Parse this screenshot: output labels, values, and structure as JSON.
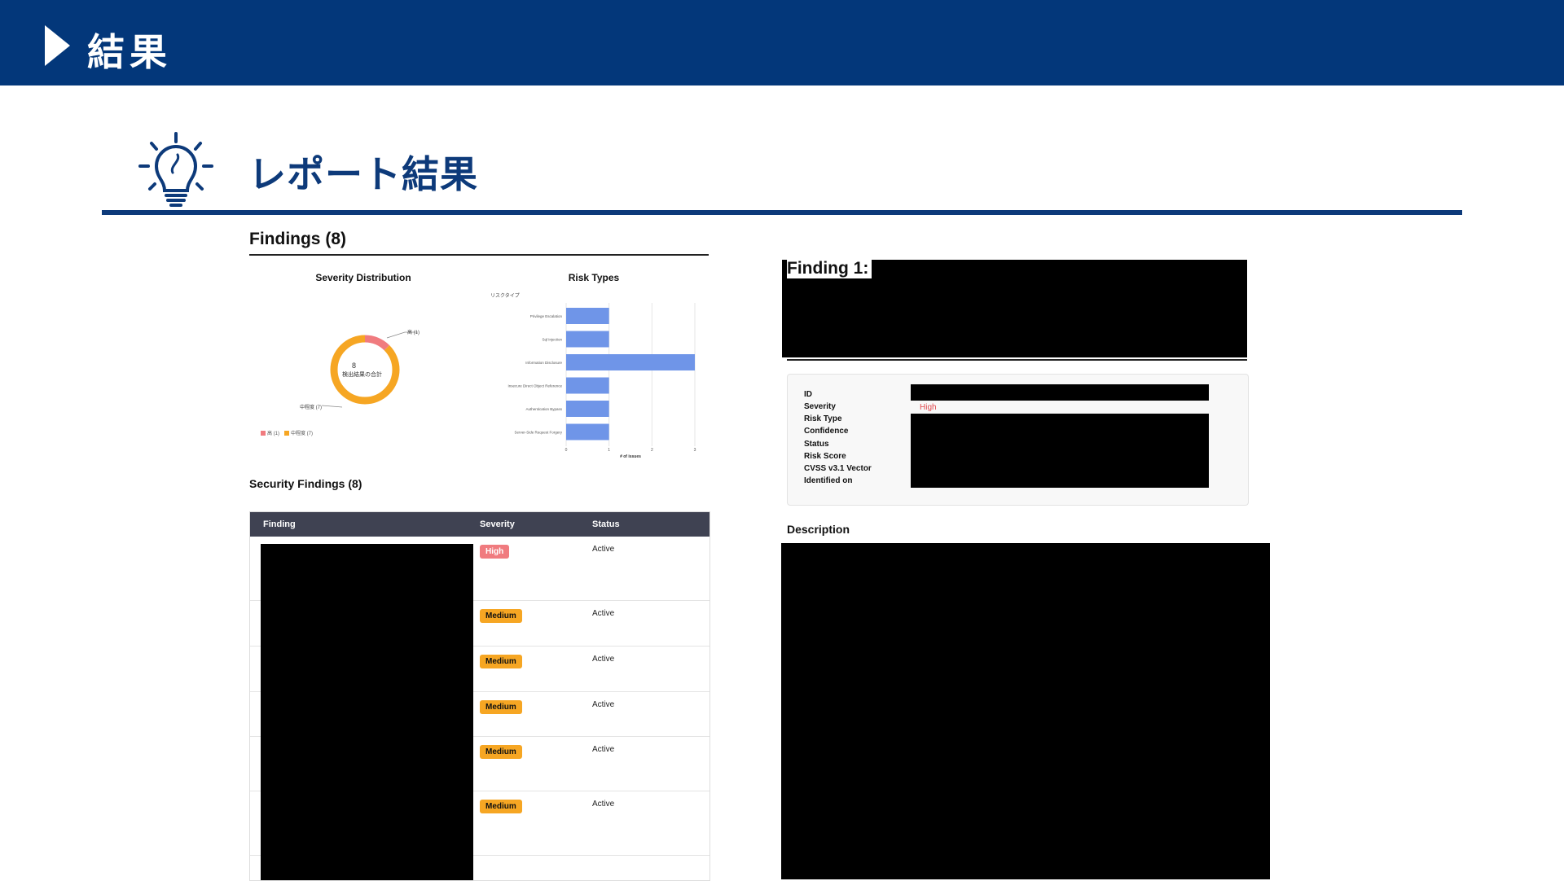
{
  "header": {
    "title": "結果"
  },
  "report": {
    "title": "レポート結果"
  },
  "findings": {
    "heading": "Findings (8)"
  },
  "severity_chart": {
    "title": "Severity Distribution",
    "center_value": "8",
    "center_label": "検出結果の合計",
    "label_high": "高 (1)",
    "label_medium": "中程度 (7)",
    "legend_high": "高 (1)",
    "legend_medium": "中程度 (7)",
    "colors": {
      "high": "#f07b7f",
      "medium": "#f6a623"
    }
  },
  "risk_chart": {
    "title": "Risk Types",
    "legend_title": "リスクタイプ",
    "xlabel": "# of issues"
  },
  "chart_data": [
    {
      "type": "pie",
      "title": "Severity Distribution",
      "categories": [
        "高 (1)",
        "中程度 (7)"
      ],
      "values": [
        1,
        7
      ],
      "colors": [
        "#f07b7f",
        "#f6a623"
      ],
      "legend": "bottom-left"
    },
    {
      "type": "bar",
      "orientation": "horizontal",
      "title": "Risk Types",
      "categories": [
        "Privilege Escalation",
        "Sql Injection",
        "Information Disclosure",
        "Insecure Direct Object Reference",
        "Authentication Bypass",
        "Server-Side Request Forgery"
      ],
      "values": [
        1,
        1,
        3,
        1,
        1,
        1
      ],
      "xlabel": "# of issues",
      "xlim": [
        0,
        3
      ],
      "xticks": [
        "0",
        "1",
        "2",
        "3"
      ],
      "color": "#6f95e8",
      "grid": true
    }
  ],
  "security_findings": {
    "heading": "Security Findings (8)",
    "columns": [
      "Finding",
      "Severity",
      "Status"
    ],
    "rows": [
      {
        "severity": "High",
        "status": "Active"
      },
      {
        "severity": "Medium",
        "status": "Active"
      },
      {
        "severity": "Medium",
        "status": "Active"
      },
      {
        "severity": "Medium",
        "status": "Active"
      },
      {
        "severity": "Medium",
        "status": "Active"
      },
      {
        "severity": "Medium",
        "status": "Active"
      }
    ]
  },
  "finding_detail": {
    "title": "Finding 1:",
    "labels": [
      "ID",
      "Severity",
      "Risk Type",
      "Confidence",
      "Status",
      "Risk Score",
      "CVSS v3.1 Vector",
      "Identified on"
    ],
    "severity_value": "High",
    "description_heading": "Description"
  }
}
